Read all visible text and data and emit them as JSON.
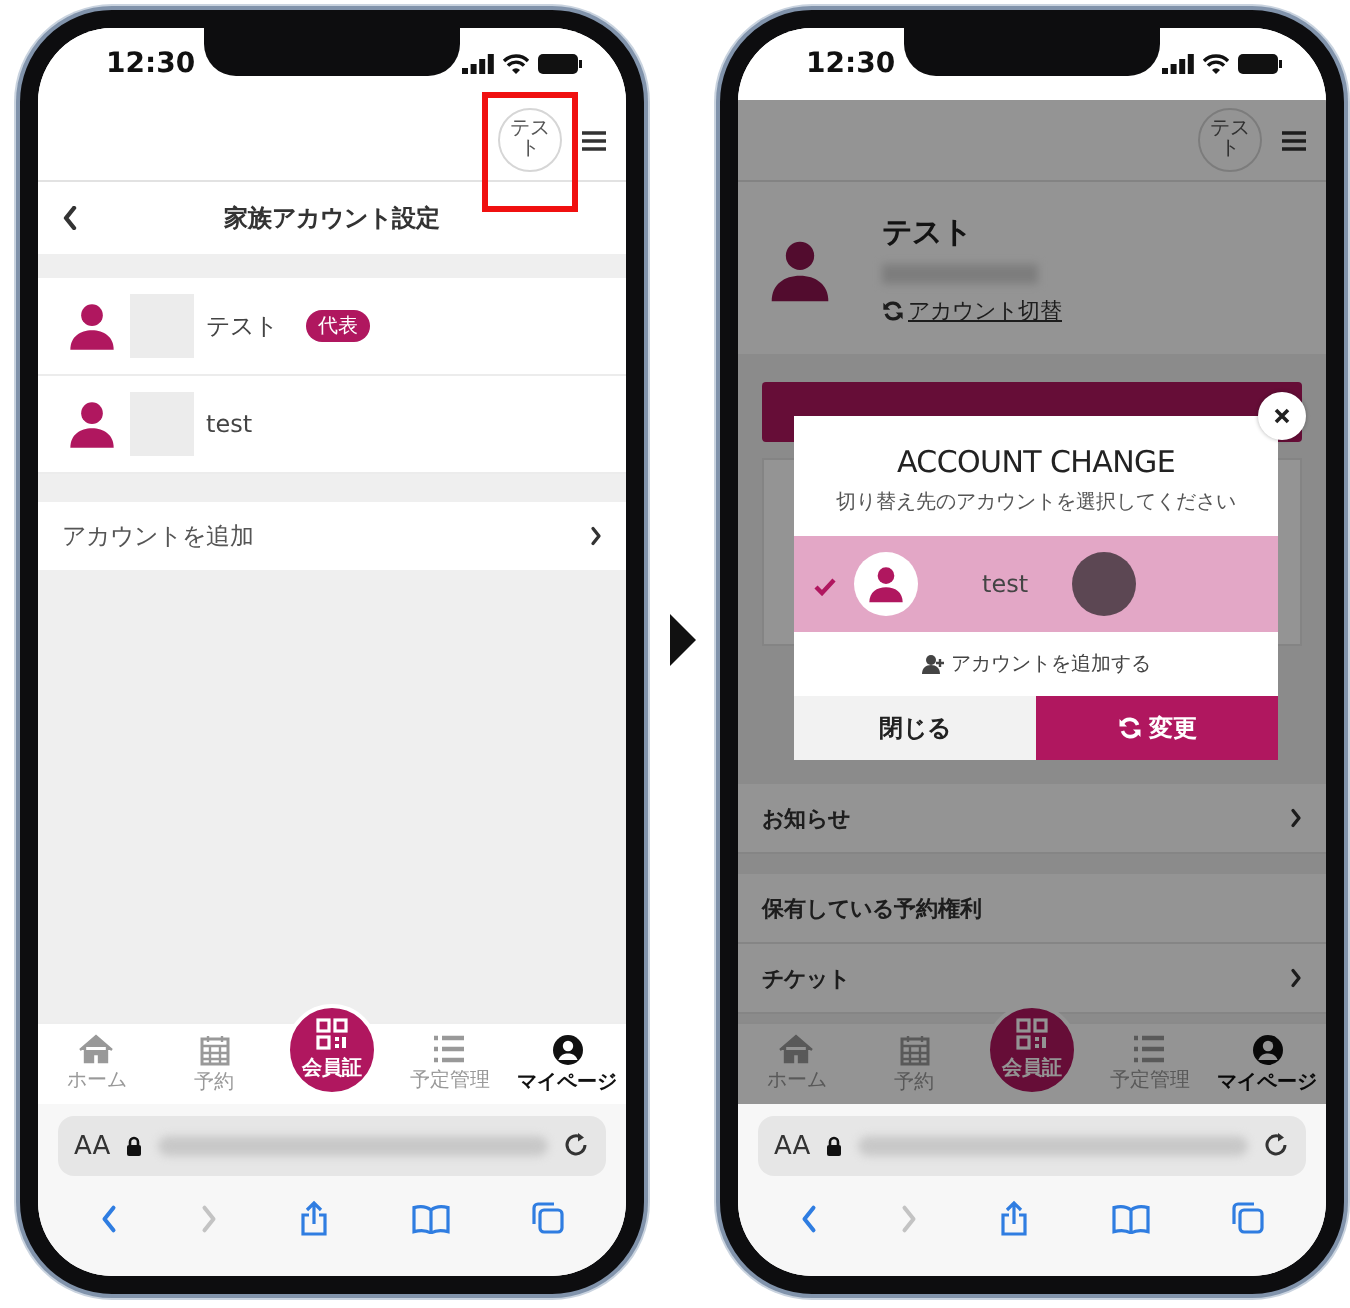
{
  "phones": [
    {
      "kind": "family_settings",
      "time": "12:30",
      "header_avatar": {
        "text": "テスト",
        "highlighted": true
      },
      "title": "家族アカウント設定",
      "accounts": [
        {
          "name": "テスト",
          "badge": "代表"
        },
        {
          "name": "test"
        }
      ],
      "add_account": "アカウントを追加",
      "tabs": [
        {
          "kind": "home",
          "label": "ホーム",
          "selected": false
        },
        {
          "kind": "calendar",
          "label": "予約",
          "selected": false
        },
        {
          "kind": "card",
          "label": "会員証",
          "selected": false
        },
        {
          "kind": "list",
          "label": "予定管理",
          "selected": false
        },
        {
          "kind": "user",
          "label": "マイページ",
          "selected": true
        }
      ],
      "browser": {
        "text_size": "AA"
      }
    },
    {
      "kind": "my_page",
      "time": "12:30",
      "header_avatar": {
        "text": "テスト"
      },
      "profile": {
        "name": "テスト",
        "switch_link": "アカウント切替"
      },
      "menu": [
        {
          "kind": "row",
          "label": "お知らせ",
          "arrow": true
        },
        {
          "kind": "section",
          "label": "保有している予約権利",
          "arrow": false
        },
        {
          "kind": "row",
          "label": "チケット",
          "arrow": true
        }
      ],
      "tabs": [
        {
          "kind": "home",
          "label": "ホーム",
          "selected": false
        },
        {
          "kind": "calendar",
          "label": "予約",
          "selected": false
        },
        {
          "kind": "card",
          "label": "会員証",
          "selected": false
        },
        {
          "kind": "list",
          "label": "予定管理",
          "selected": false
        },
        {
          "kind": "user",
          "label": "マイページ",
          "selected": true
        }
      ],
      "browser": {
        "text_size": "AA"
      },
      "modal": {
        "title": "ACCOUNT CHANGE",
        "subtitle": "切り替え先のアカウントを選択してください",
        "accounts": [
          {
            "name": "test",
            "selected": true
          }
        ],
        "add_link": "アカウントを追加する",
        "buttons": [
          {
            "kind": "close",
            "label": "閉じる"
          },
          {
            "kind": "confirm",
            "label": "変更"
          }
        ]
      }
    }
  ]
}
